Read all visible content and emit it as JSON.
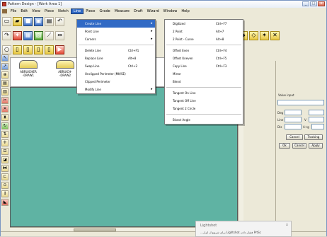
{
  "window": {
    "title": "Pattern Design - [Work Area 1]",
    "controls": {
      "minimize": "_",
      "maximize": "□",
      "close": "x"
    }
  },
  "menubar": {
    "items": [
      "File",
      "Edit",
      "View",
      "Piece",
      "Notch",
      "Line",
      "Piece",
      "Grade",
      "Measure",
      "Draft",
      "Wizard",
      "Window",
      "Help"
    ],
    "active_index": 5
  },
  "pieces": [
    {
      "label": "ABRUICHER\n-DRAW1"
    },
    {
      "label": "ABRUICH-\n-DRAW2"
    }
  ],
  "line_menu_left": {
    "items": [
      {
        "label": "Create Line",
        "shortcut": "",
        "submenu": true,
        "hover": true
      },
      {
        "label": "Point Line",
        "shortcut": "",
        "submenu": true,
        "hover": false
      },
      {
        "label": "Corners",
        "shortcut": "",
        "submenu": true,
        "hover": false
      },
      {
        "sep": true
      },
      {
        "label": "Delete Line",
        "shortcut": "Ctrl+F1",
        "submenu": false,
        "hover": false
      },
      {
        "label": "Replace Line",
        "shortcut": "Alt+8",
        "submenu": false,
        "hover": false
      },
      {
        "label": "Swap Line",
        "shortcut": "Ctrl+2",
        "submenu": false,
        "hover": false
      },
      {
        "label": "Unclipped Perimeter (MK/SE)",
        "shortcut": "",
        "submenu": false,
        "hover": false
      },
      {
        "label": "Clipped Perimeter",
        "shortcut": "",
        "submenu": false,
        "hover": false
      },
      {
        "label": "Modify Line",
        "shortcut": "",
        "submenu": true,
        "hover": false
      }
    ]
  },
  "line_menu_right": {
    "items": [
      {
        "label": "Digitized",
        "shortcut": "Ctrl+F7",
        "sep": false
      },
      {
        "label": "2 Point",
        "shortcut": "Alt+7",
        "sep": false
      },
      {
        "label": "2 Point - Curve",
        "shortcut": "Alt+8",
        "sep": false
      },
      {
        "sep": true
      },
      {
        "label": "Offset Even",
        "shortcut": "Ctrl+F4",
        "sep": false
      },
      {
        "label": "Offset Uneven",
        "shortcut": "Ctrl+F5",
        "sep": false
      },
      {
        "label": "Copy Line",
        "shortcut": "Ctrl+F3",
        "sep": false
      },
      {
        "label": "Mirror",
        "shortcut": "",
        "sep": false
      },
      {
        "label": "Blend",
        "shortcut": "",
        "sep": false
      },
      {
        "sep": true
      },
      {
        "label": "Tangent On Line",
        "shortcut": "",
        "sep": false
      },
      {
        "label": "Tangent Off Line",
        "shortcut": "",
        "sep": false
      },
      {
        "label": "Tangent 2 Circle",
        "shortcut": "",
        "sep": false
      },
      {
        "sep": true
      },
      {
        "label": "Bisect Angle",
        "shortcut": "",
        "sep": false
      }
    ]
  },
  "right_panel": {
    "value_input_label": "Value input",
    "deg_label": "Deg",
    "line_label": "Line",
    "dis_label": "Dis",
    "x_label": "X",
    "v_label": "V",
    "aug_label": "A+g",
    "cancel_btn": "Cancel",
    "tracking_btn": "Tracking",
    "ok_btn": "Ok",
    "cancel2_btn": "Cancel",
    "apply_btn": "Apply"
  },
  "lightshot": {
    "title": "Lightshot",
    "close": "x",
    "text": "...برای شروع از ابزار Lightshot فشار دادن PrtSc"
  }
}
